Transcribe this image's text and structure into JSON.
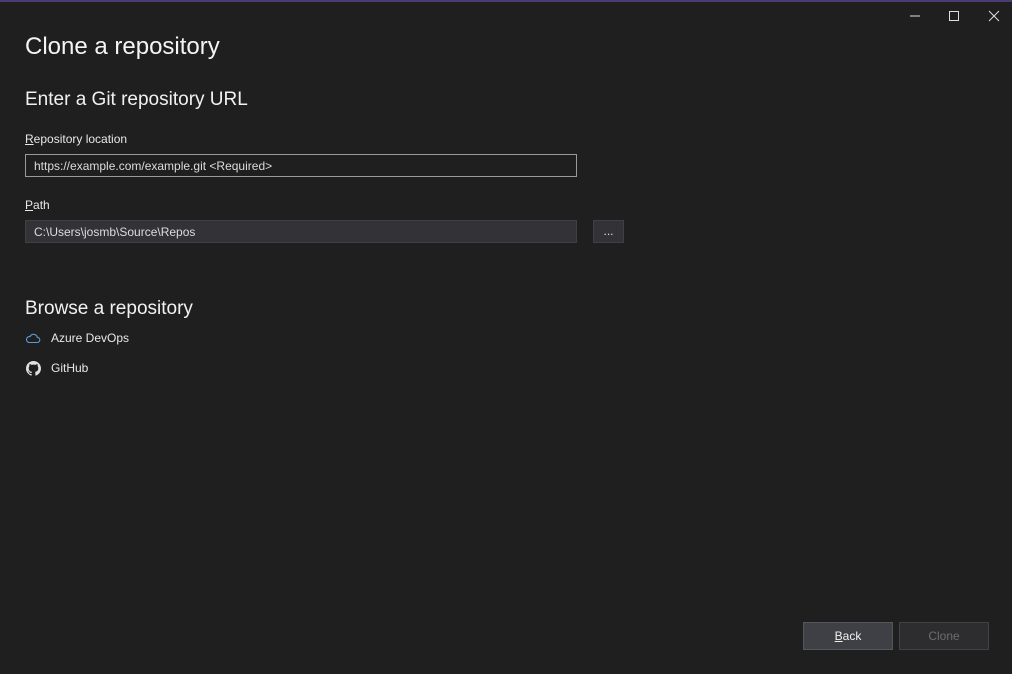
{
  "window": {
    "controls": [
      "minimize-icon",
      "maximize-icon",
      "close-icon"
    ]
  },
  "page": {
    "title": "Clone a repository"
  },
  "git_url": {
    "heading": "Enter a Git repository URL",
    "repo_label_key": "R",
    "repo_label_rest": "epository location",
    "repo_placeholder": "https://example.com/example.git <Required>",
    "repo_value": "",
    "path_label_key": "P",
    "path_label_rest": "ath",
    "path_value": "C:\\Users\\josmb\\Source\\Repos",
    "browse_label": "..."
  },
  "browse": {
    "heading": "Browse a repository",
    "providers": [
      {
        "label": "Azure DevOps",
        "icon": "cloud-icon"
      },
      {
        "label": "GitHub",
        "icon": "github-icon"
      }
    ]
  },
  "footer": {
    "back_key": "B",
    "back_rest": "ack",
    "clone_label": "Clone"
  },
  "colors": {
    "background": "#1f1f1f",
    "accent_line": "#4a3b73",
    "azure_icon": "#5a9bd5"
  }
}
